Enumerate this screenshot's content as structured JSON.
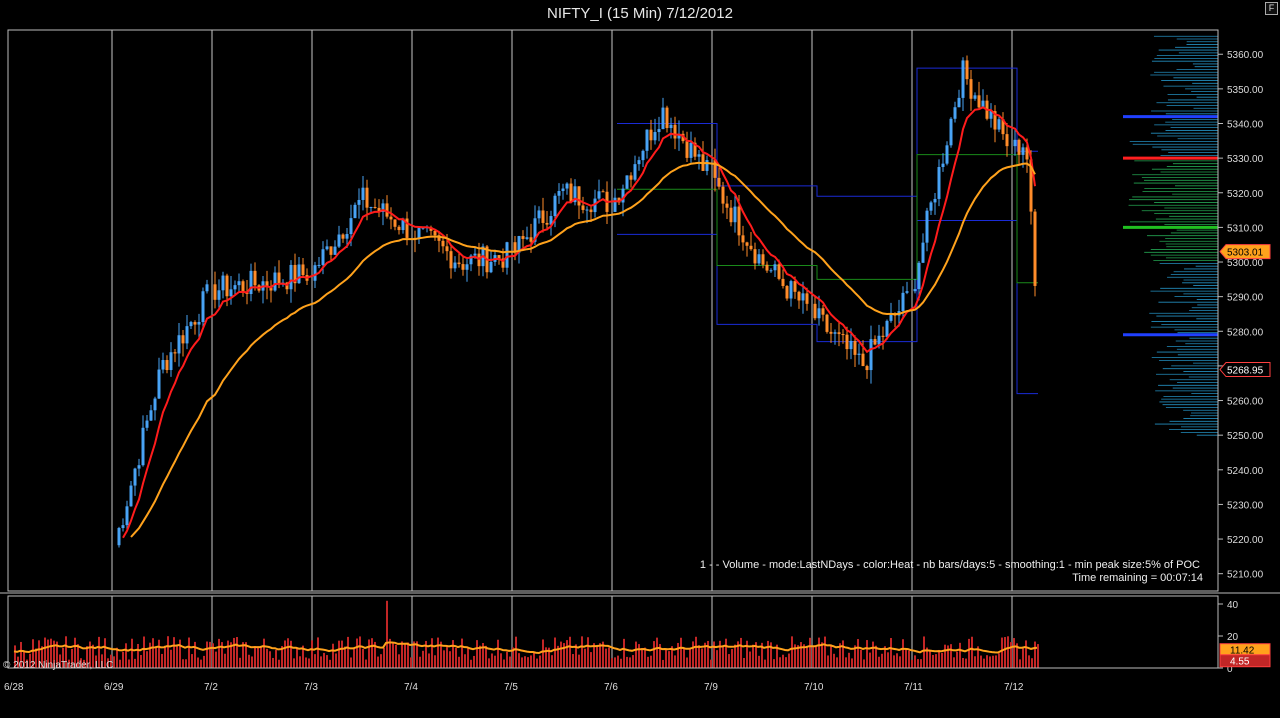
{
  "title": "NIFTY_I (15 Min)  7/12/2012",
  "f_button": "F",
  "indicator_text": "1 -  - Volume - mode:LastNDays  - color:Heat - nb bars/days:5 - smoothing:1 - min peak size:5% of POC",
  "time_remaining": "Time remaining = 00:07:14",
  "copyright": "© 2012 NinjaTrader, LLC",
  "colors": {
    "bull": "#49a3f5",
    "bear": "#ff8c2a",
    "fast_ma": "#ff1c1c",
    "slow_ma": "#ffa21c",
    "envelope": "#1a2bd6",
    "mid": "#1a8a1a",
    "volume_bar": "#c22626",
    "volume_ma": "#ffa21c",
    "grid": "#c8c8c8"
  },
  "chart_data": [
    {
      "type": "candlestick",
      "title": "NIFTY_I (15 Min)  7/12/2012",
      "x_tick_labels": [
        "6/28",
        "6/29",
        "7/2",
        "7/3",
        "7/4",
        "7/5",
        "7/6",
        "7/9",
        "7/10",
        "7/11",
        "7/12"
      ],
      "y_ticks": [
        5210,
        5220,
        5230,
        5240,
        5250,
        5260,
        5270,
        5280,
        5290,
        5300,
        5310,
        5320,
        5330,
        5340,
        5350,
        5360
      ],
      "y_tick_labels": [
        "5210.00",
        "5220.00",
        "5230.00",
        "5240.00",
        "5250.00",
        "5260.00",
        "5270.00",
        "5280.00",
        "5290.00",
        "5300.00",
        "5310.00",
        "5320.00",
        "5330.00",
        "5340.00",
        "5350.00",
        "5360.00"
      ],
      "ylim": [
        5205,
        5367
      ],
      "grid": "vertical",
      "session_close": [
        5266,
        5292,
        5297,
        5309,
        5302,
        5317,
        5324,
        5285,
        5292,
        5332,
        5268.95
      ],
      "last_price": 5268.95,
      "last_price_label": "5268.95",
      "ma_level": 5303.01,
      "ma_level_label": "5303.01",
      "session_range": [
        [
          5210,
          5235
        ],
        [
          5215,
          5300
        ],
        [
          5278,
          5325
        ],
        [
          5283,
          5330
        ],
        [
          5292,
          5322
        ],
        [
          5312,
          5352
        ],
        [
          5296,
          5346
        ],
        [
          5270,
          5328
        ],
        [
          5265,
          5325
        ],
        [
          5300,
          5362
        ],
        [
          5250,
          5338
        ]
      ],
      "volume_profile_peaks": [
        5342,
        5330,
        5310,
        5279
      ]
    },
    {
      "type": "bar",
      "title": "Volume",
      "y_ticks": [
        0,
        20,
        40
      ],
      "y_tick_labels": [
        "0",
        "20",
        "40"
      ],
      "ylim": [
        0,
        45
      ],
      "current_volume": 4.55,
      "current_volume_label": "4.55",
      "volume_ma": 11.42,
      "volume_ma_label": "11.42",
      "typical_range": [
        5,
        20
      ],
      "spike": 42
    }
  ]
}
